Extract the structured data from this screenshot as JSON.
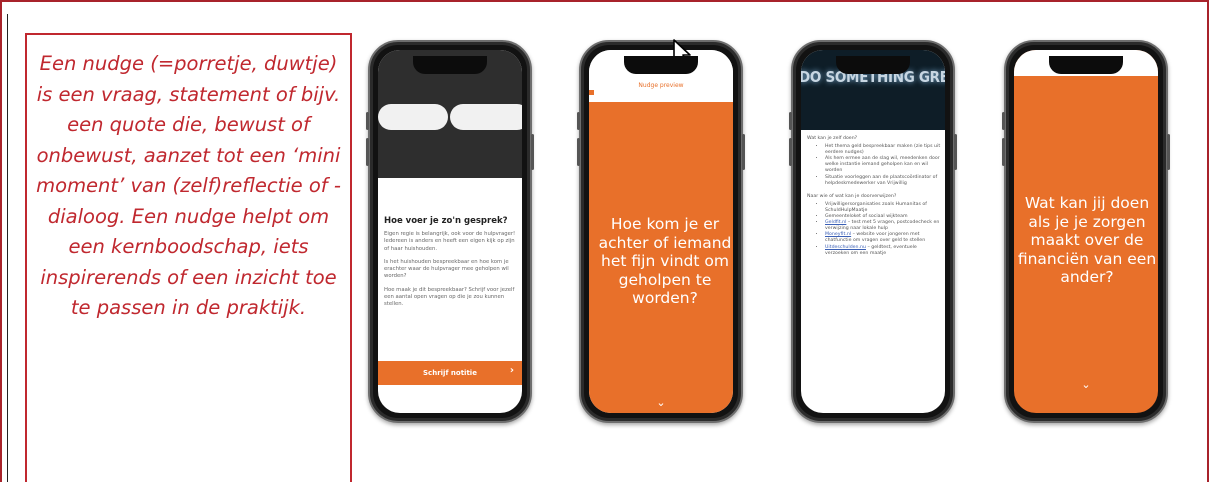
{
  "description_box": {
    "text": "Een nudge (=porretje, duwtje) is een vraag, statement of bijv. een quote die, bewust of onbewust, aanzet tot een ‘mini moment’ van (zelf)reflectie of -dialoog. Een nudge helpt om een kernboodschap, iets inspirerends of een inzicht toe te passen in de praktijk."
  },
  "phone1": {
    "title": "Hoe voer je zo'n gesprek?",
    "paragraphs": [
      "Eigen regie is belangrijk, ook voor de hulpvrager! Iedereen is anders en heeft een eigen kijk op zijn of haar huishouden.",
      "Is het huishouden bespreekbaar en hoe kom je erachter waar de hulpvrager mee geholpen wil worden?",
      "Hoe maak je dit bespreekbaar? Schrijf voor jezelf een aantal open vragen op die je zou kunnen stellen."
    ],
    "button_label": "Schrijf notitie",
    "button_icon": "chevron-right-icon"
  },
  "phone2": {
    "header": "Nudge preview",
    "question": "Hoe kom je er achter of iemand het fijn vindt om geholpen te worden?",
    "chevron_icon": "chevron-down-icon"
  },
  "phone3": {
    "banner": "DO SOMETHING GREAT",
    "section1_title": "Wat kan je zelf doen?",
    "section1_items": [
      "Het thema geld bespreekbaar maken (zie tips uit eerdere nudges)",
      "Als hem ermee aan de slag wil, meedenken door welke instantie iemand geholpen kan en wil worden",
      "Situatie voorleggen aan de plaatscoördinator of helpdeskmedewerker van Vrijwillig"
    ],
    "section2_title": "Naar wie of wat kan je doorverwijzen?",
    "section2_items": [
      {
        "link": "",
        "text": "Vrijwilligersorganisaties zoals Humanitas of SchuldHulpMaatje"
      },
      {
        "link": "",
        "text": "Gemeenteloket of sociaal wijkteam"
      },
      {
        "link": "Geldfit.nl",
        "text": " – test met 5 vragen, postcodecheck en verwijzing naar lokale hulp"
      },
      {
        "link": "Moneyfit.nl",
        "text": " – website voor jongeren met chatfunctie om vragen over geld te stellen"
      },
      {
        "link": "Uitdeschulden.nu",
        "text": " – geldtest, eventuele verzoeken om een maatje"
      }
    ]
  },
  "phone4": {
    "question": "Wat kan jij doen als je je zorgen maakt over de financiën van een ander?",
    "chevron_icon": "chevron-down-icon"
  },
  "colors": {
    "accent_red": "#c0282f",
    "orange": "#e8702a"
  }
}
